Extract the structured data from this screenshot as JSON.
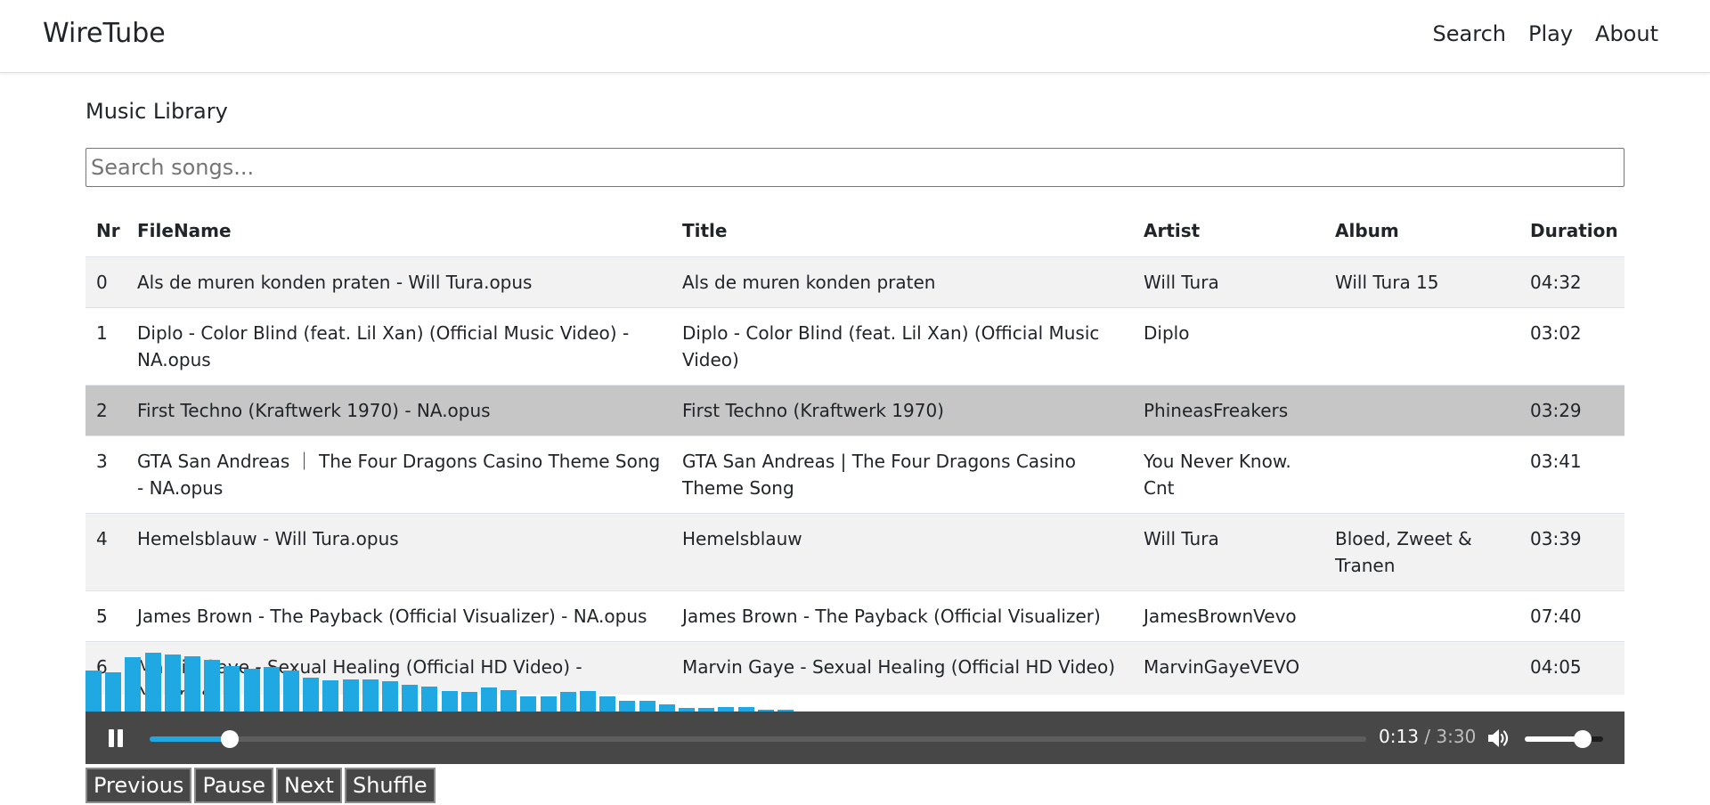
{
  "navbar": {
    "brand": "WireTube",
    "links": [
      "Search",
      "Play",
      "About"
    ]
  },
  "library": {
    "title": "Music Library",
    "search_placeholder": "Search songs...",
    "columns": [
      "Nr",
      "FileName",
      "Title",
      "Artist",
      "Album",
      "Duration"
    ],
    "rows": [
      {
        "nr": "0",
        "filename": "Als de muren konden praten - Will Tura.opus",
        "title": "Als de muren konden praten",
        "artist": "Will Tura",
        "album": "Will Tura 15",
        "duration": "04:32"
      },
      {
        "nr": "1",
        "filename": "Diplo - Color Blind (feat. Lil Xan) (Official Music Video) - NA.opus",
        "title": "Diplo - Color Blind (feat. Lil Xan) (Official Music Video)",
        "artist": "Diplo",
        "album": "",
        "duration": "03:02"
      },
      {
        "nr": "2",
        "filename": "First Techno (Kraftwerk 1970) - NA.opus",
        "title": "First Techno (Kraftwerk 1970)",
        "artist": "PhineasFreakers",
        "album": "",
        "duration": "03:29"
      },
      {
        "nr": "3",
        "filename": "GTA San Andreas ｜ The Four Dragons Casino Theme Song - NA.opus",
        "title": "GTA San Andreas | The Four Dragons Casino Theme Song",
        "artist": "You Never Know. Cnt",
        "album": "",
        "duration": "03:41"
      },
      {
        "nr": "4",
        "filename": "Hemelsblauw - Will Tura.opus",
        "title": "Hemelsblauw",
        "artist": "Will Tura",
        "album": "Bloed, Zweet & Tranen",
        "duration": "03:39"
      },
      {
        "nr": "5",
        "filename": "James Brown - The Payback (Official Visualizer) - NA.opus",
        "title": "James Brown - The Payback (Official Visualizer)",
        "artist": "JamesBrownVevo",
        "album": "",
        "duration": "07:40"
      },
      {
        "nr": "6",
        "filename": "Marvin Gaye - Sexual Healing (Official HD Video) - NA.opus",
        "title": "Marvin Gaye - Sexual Healing (Official HD Video)",
        "artist": "MarvinGayeVEVO",
        "album": "",
        "duration": "04:05"
      }
    ],
    "selected_row": 2
  },
  "visualizer_levels": [
    0.55,
    0.53,
    0.73,
    0.79,
    0.77,
    0.75,
    0.7,
    0.62,
    0.58,
    0.6,
    0.56,
    0.46,
    0.42,
    0.43,
    0.43,
    0.41,
    0.36,
    0.34,
    0.28,
    0.26,
    0.32,
    0.29,
    0.2,
    0.2,
    0.26,
    0.28,
    0.2,
    0.15,
    0.15,
    0.1,
    0.05,
    0.05,
    0.06,
    0.06,
    0.03,
    0.02
  ],
  "player": {
    "current_time": "0:13",
    "separator": " / ",
    "duration": "3:30",
    "progress": 0.066,
    "volume": 0.74,
    "accent_color": "#1fa8e2",
    "bar_color": "#474747",
    "play_state_icon": "pause-icon",
    "volume_icon": "speaker-icon"
  },
  "controls": [
    "Previous",
    "Pause",
    "Next",
    "Shuffle"
  ]
}
